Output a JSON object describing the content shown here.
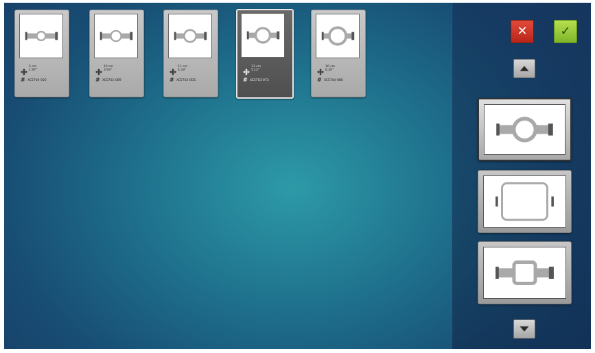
{
  "hoop_cards": [
    {
      "size": "5 cm",
      "inch": "1.97\"",
      "part": "XC5700-050",
      "selected": false
    },
    {
      "size": "10 cm",
      "inch": "3.93\"",
      "part": "XC5701-0B9",
      "selected": false
    },
    {
      "size": "11 cm",
      "inch": "4.33\"",
      "part": "XC5702-0DS",
      "selected": false
    },
    {
      "size": "13 cm",
      "inch": "5.12\"",
      "part": "XC5703-073",
      "selected": false
    },
    {
      "size": "16 cm",
      "inch": "6.30\"",
      "part": "XC5704-0B6",
      "selected": false
    }
  ],
  "toolbar": {
    "cancel_symbol": "✕",
    "confirm_symbol": "✓"
  },
  "icons": {
    "cancel": "close-icon",
    "confirm": "checkmark-icon",
    "up": "triangle-up-icon",
    "down": "triangle-down-icon",
    "move": "move-arrows-icon",
    "hash": "hash-icon"
  },
  "colors": {
    "cancel": "#d23a2b",
    "confirm": "#9ccb3d",
    "accent_bg": "#1e6f8b"
  },
  "hoop_list": [
    {
      "type": "round-hoop",
      "selected": true
    },
    {
      "type": "large-rectangle-hoop",
      "selected": false
    },
    {
      "type": "square-hoop",
      "selected": false
    }
  ]
}
